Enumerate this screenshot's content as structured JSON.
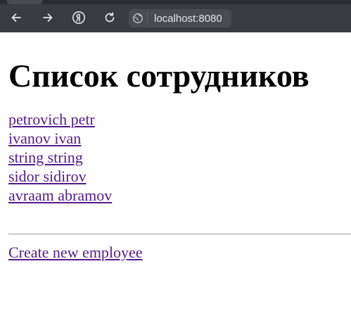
{
  "browser": {
    "url": "localhost:8080",
    "icons": {
      "back": "arrow-left-icon",
      "forward": "arrow-right-icon",
      "yandex": "yandex-logo-icon",
      "reload": "reload-icon",
      "site_info": "site-info-icon"
    },
    "colors": {
      "chrome_bg": "#3a3a41",
      "address_bg": "#4a4a52",
      "icon": "#e6e6ea"
    }
  },
  "page": {
    "title": "Список сотрудников",
    "employees": [
      "petrovich petr",
      "ivanov ivan",
      "string string",
      "sidor sidirov",
      "avraam abramov"
    ],
    "create_link": "Create new employee",
    "colors": {
      "visited_link": "#551a8b",
      "text": "#000000"
    }
  }
}
